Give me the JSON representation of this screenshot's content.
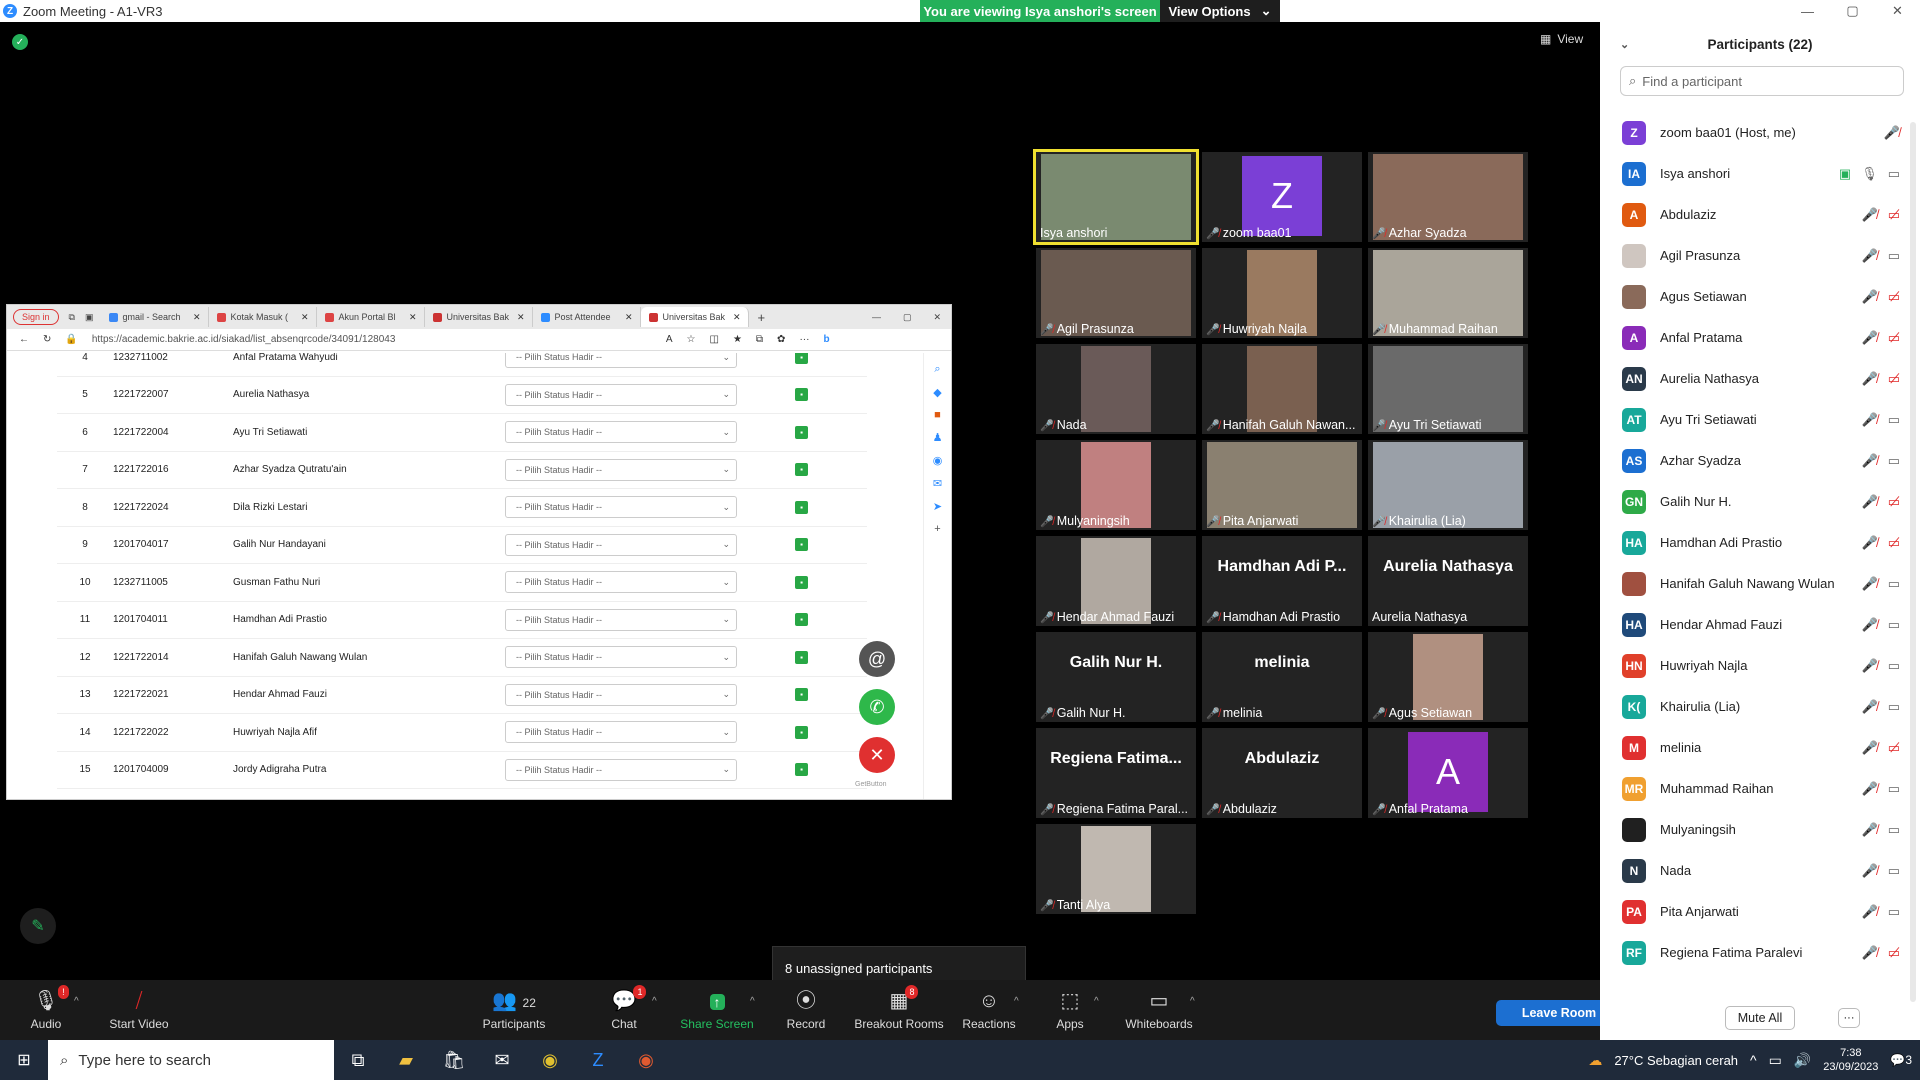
{
  "window": {
    "title": "Zoom Meeting - A1-VR3",
    "min": "—",
    "max": "▢",
    "close": "✕"
  },
  "banner": {
    "viewing": "You are viewing Isya anshori's screen",
    "view_options": "View Options"
  },
  "view_btn": "View",
  "browser": {
    "signin": "Sign in",
    "tabs": [
      {
        "label": "gmail - Search",
        "color": "#3b88f5"
      },
      {
        "label": "Kotak Masuk (",
        "color": "#d44"
      },
      {
        "label": "Akun Portal Bl",
        "color": "#d44"
      },
      {
        "label": "Universitas Bak",
        "color": "#c33"
      },
      {
        "label": "Post Attendee",
        "color": "#2d8cff"
      },
      {
        "label": "Universitas Bak",
        "color": "#c33"
      }
    ],
    "url": "https://academic.bakrie.ac.id/siakad/list_absenqrcode/34091/128043",
    "rows": [
      {
        "no": "4",
        "nim": "1232711002",
        "name": "Anfal Pratama Wahyudi",
        "status": "-- Pilih Status Hadir --"
      },
      {
        "no": "5",
        "nim": "1221722007",
        "name": "Aurelia Nathasya",
        "status": "-- Pilih Status Hadir --"
      },
      {
        "no": "6",
        "nim": "1221722004",
        "name": "Ayu Tri Setiawati",
        "status": "-- Pilih Status Hadir --"
      },
      {
        "no": "7",
        "nim": "1221722016",
        "name": "Azhar Syadza Qutratu'ain",
        "status": "-- Pilih Status Hadir --"
      },
      {
        "no": "8",
        "nim": "1221722024",
        "name": "Dila Rizki Lestari",
        "status": "-- Pilih Status Hadir --"
      },
      {
        "no": "9",
        "nim": "1201704017",
        "name": "Galih Nur Handayani",
        "status": "-- Pilih Status Hadir --"
      },
      {
        "no": "10",
        "nim": "1232711005",
        "name": "Gusman Fathu Nuri",
        "status": "-- Pilih Status Hadir --"
      },
      {
        "no": "11",
        "nim": "1201704011",
        "name": "Hamdhan Adi Prastio",
        "status": "-- Pilih Status Hadir --"
      },
      {
        "no": "12",
        "nim": "1221722014",
        "name": "Hanifah Galuh Nawang Wulan",
        "status": "-- Pilih Status Hadir --"
      },
      {
        "no": "13",
        "nim": "1221722021",
        "name": "Hendar Ahmad Fauzi",
        "status": "-- Pilih Status Hadir --"
      },
      {
        "no": "14",
        "nim": "1221722022",
        "name": "Huwriyah Najla Afif",
        "status": "-- Pilih Status Hadir --"
      },
      {
        "no": "15",
        "nim": "1201704009",
        "name": "Jordy Adigraha Putra",
        "status": "-- Pilih Status Hadir --"
      }
    ],
    "getbutton": "GetButton"
  },
  "gallery": [
    {
      "name": "Isya anshori",
      "muted": false,
      "kind": "photo",
      "color": "#7a8a70",
      "active": true
    },
    {
      "name": "zoom baa01",
      "muted": true,
      "kind": "avatar",
      "letter": "Z",
      "color": "#7b3fd6"
    },
    {
      "name": "Azhar Syadza",
      "muted": true,
      "kind": "photo",
      "color": "#8a6a5a"
    },
    {
      "name": "Agil Prasunza",
      "muted": true,
      "kind": "photo",
      "color": "#6a5a50"
    },
    {
      "name": "Huwriyah Najla",
      "muted": true,
      "kind": "photo",
      "color": "#9a7a60"
    },
    {
      "name": "Muhammad Raihan",
      "muted": true,
      "kind": "photo",
      "color": "#aaa59a"
    },
    {
      "name": "Nada",
      "muted": true,
      "kind": "photo",
      "color": "#6a5a58"
    },
    {
      "name": "Hanifah Galuh Nawan...",
      "muted": true,
      "kind": "photo",
      "color": "#7a6050"
    },
    {
      "name": "Ayu Tri Setiawati",
      "muted": true,
      "kind": "photo",
      "color": "#6a6a6a"
    },
    {
      "name": "Mulyaningsih",
      "muted": true,
      "kind": "photo",
      "color": "#c08080"
    },
    {
      "name": "Pita Anjarwati",
      "muted": true,
      "kind": "photo",
      "color": "#8a8070"
    },
    {
      "name": "Khairulia (Lia)",
      "muted": true,
      "kind": "photo",
      "color": "#9aa0a8"
    },
    {
      "name": "Hendar Ahmad Fauzi",
      "muted": true,
      "kind": "photo",
      "color": "#b0a8a0"
    },
    {
      "name": "Hamdhan Adi Prastio",
      "muted": true,
      "kind": "text",
      "big": "Hamdhan Adi P..."
    },
    {
      "name": "Aurelia Nathasya",
      "muted": false,
      "kind": "text",
      "big": "Aurelia Nathasya"
    },
    {
      "name": "Galih Nur H.",
      "muted": true,
      "kind": "text",
      "big": "Galih Nur H."
    },
    {
      "name": "melinia",
      "muted": true,
      "kind": "text",
      "big": "melinia"
    },
    {
      "name": "Agus Setiawan",
      "muted": true,
      "kind": "photo",
      "color": "#b09080"
    },
    {
      "name": "Regiena Fatima Paral...",
      "muted": true,
      "kind": "text",
      "big": "Regiena Fatima..."
    },
    {
      "name": "Abdulaziz",
      "muted": true,
      "kind": "text",
      "big": "Abdulaziz"
    },
    {
      "name": "Anfal Pratama",
      "muted": true,
      "kind": "avatar",
      "letter": "A",
      "color": "#8a2bb8"
    },
    {
      "name": "Tanti Alya",
      "muted": true,
      "kind": "photo",
      "color": "#c0b8b0"
    }
  ],
  "unassigned": "8 unassigned participants",
  "toolbar": {
    "audio": "Audio",
    "audio_badge": "!",
    "start_video": "Start Video",
    "participants": "Participants",
    "participants_count": "22",
    "chat": "Chat",
    "chat_badge": "1",
    "share": "Share Screen",
    "record": "Record",
    "breakout": "Breakout Rooms",
    "breakout_badge": "8",
    "reactions": "Reactions",
    "apps": "Apps",
    "whiteboards": "Whiteboards",
    "leave": "Leave Room"
  },
  "panel": {
    "title": "Participants (22)",
    "find_placeholder": "Find a participant",
    "mute_all": "Mute All",
    "more": "···",
    "people": [
      {
        "name": "zoom baa01 (Host, me)",
        "initials": "Z",
        "color": "#7b3fd6",
        "mic": "off",
        "video": "none"
      },
      {
        "name": "Isya anshori",
        "initials": "IA",
        "color": "#1c6fd1",
        "mic": "on",
        "video": "on",
        "share": true
      },
      {
        "name": "Abdulaziz",
        "initials": "A",
        "color": "#e05a10",
        "mic": "off",
        "video": "off"
      },
      {
        "name": "Agil Prasunza",
        "initials": "",
        "color": "#cfc6c0",
        "mic": "off",
        "video": "on"
      },
      {
        "name": "Agus Setiawan",
        "initials": "",
        "color": "#8a6a5a",
        "mic": "off",
        "video": "off"
      },
      {
        "name": "Anfal Pratama",
        "initials": "A",
        "color": "#8a2bb8",
        "mic": "off",
        "video": "off"
      },
      {
        "name": "Aurelia Nathasya",
        "initials": "AN",
        "color": "#2a3a4a",
        "mic": "off",
        "video": "off"
      },
      {
        "name": "Ayu Tri Setiawati",
        "initials": "AT",
        "color": "#18a89a",
        "mic": "off",
        "video": "on"
      },
      {
        "name": "Azhar Syadza",
        "initials": "AS",
        "color": "#1c6fd1",
        "mic": "off",
        "video": "on"
      },
      {
        "name": "Galih Nur H.",
        "initials": "GN",
        "color": "#2eaa48",
        "mic": "off",
        "video": "off"
      },
      {
        "name": "Hamdhan Adi Prastio",
        "initials": "HA",
        "color": "#18a89a",
        "mic": "off",
        "video": "off"
      },
      {
        "name": "Hanifah Galuh Nawang Wulan",
        "initials": "",
        "color": "#a05040",
        "mic": "off",
        "video": "on"
      },
      {
        "name": "Hendar Ahmad Fauzi",
        "initials": "HA",
        "color": "#1f4a7a",
        "mic": "off",
        "video": "on"
      },
      {
        "name": "Huwriyah Najla",
        "initials": "HN",
        "color": "#e0402a",
        "mic": "off",
        "video": "on"
      },
      {
        "name": "Khairulia (Lia)",
        "initials": "K(",
        "color": "#18a89a",
        "mic": "off",
        "video": "on"
      },
      {
        "name": "melinia",
        "initials": "M",
        "color": "#e03030",
        "mic": "off",
        "video": "off"
      },
      {
        "name": "Muhammad Raihan",
        "initials": "MR",
        "color": "#f0a030",
        "mic": "off",
        "video": "on"
      },
      {
        "name": "Mulyaningsih",
        "initials": "",
        "color": "#202020",
        "mic": "off",
        "video": "on"
      },
      {
        "name": "Nada",
        "initials": "N",
        "color": "#2a3a4a",
        "mic": "off",
        "video": "on"
      },
      {
        "name": "Pita Anjarwati",
        "initials": "PA",
        "color": "#e03030",
        "mic": "off",
        "video": "on"
      },
      {
        "name": "Regiena Fatima Paralevi",
        "initials": "RF",
        "color": "#18a89a",
        "mic": "off",
        "video": "off"
      }
    ]
  },
  "taskbar": {
    "search": "Type here to search",
    "weather": "27°C  Sebagian cerah",
    "time": "7:38",
    "date": "23/09/2023",
    "notif": "3"
  }
}
